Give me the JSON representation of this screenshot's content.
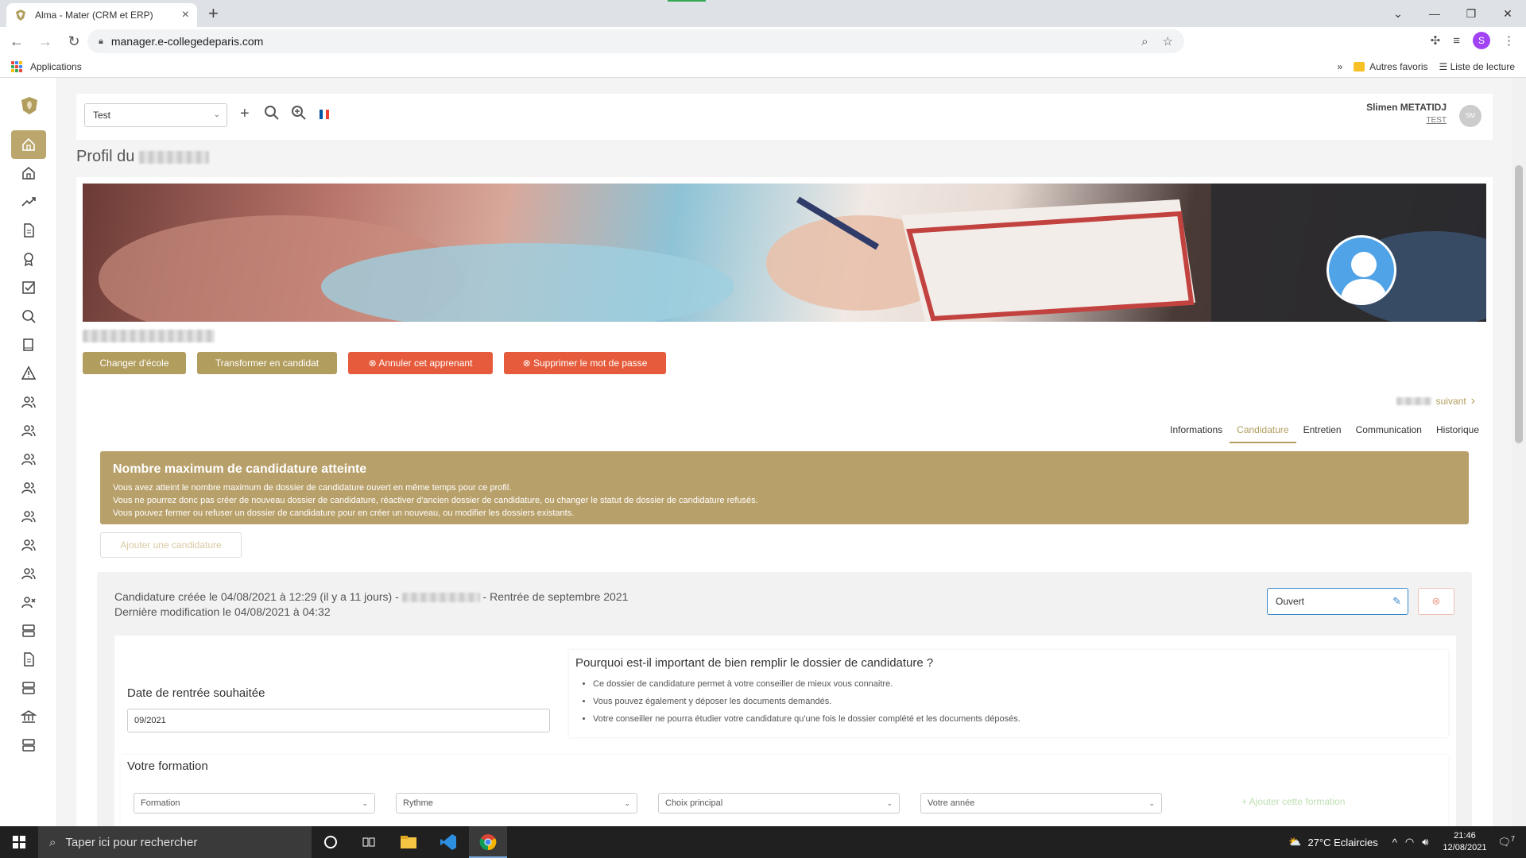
{
  "browser": {
    "tab_title": "Alma - Mater (CRM et ERP)",
    "url": "manager.e-collegedeparis.com",
    "bookmark_apps": "Applications",
    "bookmark_more": "»",
    "bookmark_folder": "Autres favoris",
    "reading_list": "Liste de lecture",
    "profile_letter": "S"
  },
  "topbar": {
    "school_select": "Test",
    "user_name": "Slimen METATIDJ",
    "user_role": "TEST",
    "user_initials": "SM"
  },
  "page": {
    "title_prefix": "Profil du"
  },
  "actions": {
    "change_school": "Changer d'école",
    "to_candidate": "Transformer en candidat",
    "cancel_learner": "Annuler cet apprenant",
    "delete_password": "Supprimer le mot de passe"
  },
  "next_label": "suivant",
  "tabs": [
    {
      "label": "Informations"
    },
    {
      "label": "Candidature"
    },
    {
      "label": "Entretien"
    },
    {
      "label": "Communication"
    },
    {
      "label": "Historique"
    }
  ],
  "alert": {
    "title": "Nombre maximum de candidature atteinte",
    "line1": "Vous avez atteint le nombre maximum de dossier de candidature ouvert en même temps pour ce profil.",
    "line2": "Vous ne pourrez donc pas créer de nouveau dossier de candidature, réactiver d'ancien dossier de candidature, ou changer le statut de dossier de candidature refusés.",
    "line3": "Vous pouvez fermer ou refuser un dossier de candidature pour en créer un nouveau, ou modifier les dossiers existants."
  },
  "add_application": "Ajouter une candidature",
  "application": {
    "created": "Candidature créée le 04/08/2021 à 12:29 (il y a 11 jours) -",
    "rentree": "- Rentrée de septembre 2021",
    "modified": "Dernière modification le 04/08/2021 à 04:32",
    "status": "Ouvert"
  },
  "date_section": {
    "title": "Date de rentrée souhaitée",
    "value": "09/2021"
  },
  "why": {
    "title": "Pourquoi est-il important de bien remplir le dossier de candidature ?",
    "items": [
      "Ce dossier de candidature permet à votre conseiller de mieux vous connaitre.",
      "Vous pouvez également y déposer les documents demandés.",
      "Votre conseiller ne pourra étudier votre candidature qu'une fois le dossier complété et les documents déposés."
    ]
  },
  "formation": {
    "title": "Votre formation",
    "fields": [
      "Formation",
      "Rythme",
      "Choix principal",
      "Votre année"
    ],
    "add_label": "+ Ajouter cette formation"
  },
  "taskbar": {
    "search_placeholder": "Taper ici pour rechercher",
    "weather": "27°C  Eclaircies",
    "time": "21:46",
    "date": "12/08/2021",
    "notif_count": "7"
  }
}
